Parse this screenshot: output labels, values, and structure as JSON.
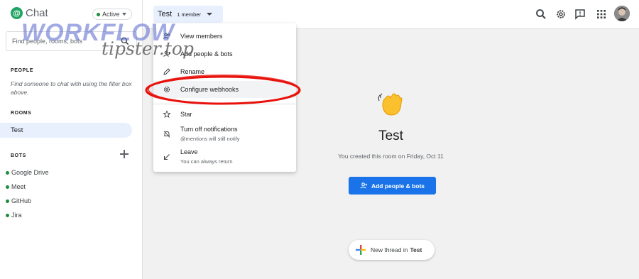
{
  "app": {
    "name": "Chat",
    "status": "Active"
  },
  "sidebar": {
    "search_placeholder": "Find people, rooms, bots",
    "people_label": "PEOPLE",
    "people_hint": "Find someone to chat with using the filter box above.",
    "rooms_label": "ROOMS",
    "rooms": [
      {
        "label": "Test"
      }
    ],
    "bots_label": "BOTS",
    "bots": [
      {
        "label": "Google Drive"
      },
      {
        "label": "Meet"
      },
      {
        "label": "GitHub"
      },
      {
        "label": "Jira"
      }
    ]
  },
  "topbar": {
    "room_title": "Test",
    "member_count": "1 member"
  },
  "menu": {
    "items": [
      {
        "label": "View members",
        "icon": "people-icon"
      },
      {
        "label": "Add people & bots",
        "icon": "person-add-icon"
      },
      {
        "label": "Rename",
        "icon": "pencil-icon"
      },
      {
        "label": "Configure webhooks",
        "icon": "gear-icon"
      },
      {
        "label": "Star",
        "icon": "star-icon"
      },
      {
        "label": "Turn off notifications",
        "sublabel": "@mentions will still notify",
        "icon": "bell-off-icon"
      },
      {
        "label": "Leave",
        "sublabel": "You can always return",
        "icon": "leave-arrow-icon"
      }
    ]
  },
  "main": {
    "room_title": "Test",
    "created_text": "You created this room on Friday, Oct 11",
    "add_button_label": "Add people & bots",
    "new_thread_prefix": "New thread in",
    "new_thread_room": "Test"
  },
  "watermark": {
    "line1": "WORKFLOW",
    "line2": "tipster.top"
  },
  "colors": {
    "accent": "#1a73e8",
    "active_green": "#1e8e3e",
    "selected_bg": "#e8f0fe",
    "annotation_red": "#e8120c"
  }
}
